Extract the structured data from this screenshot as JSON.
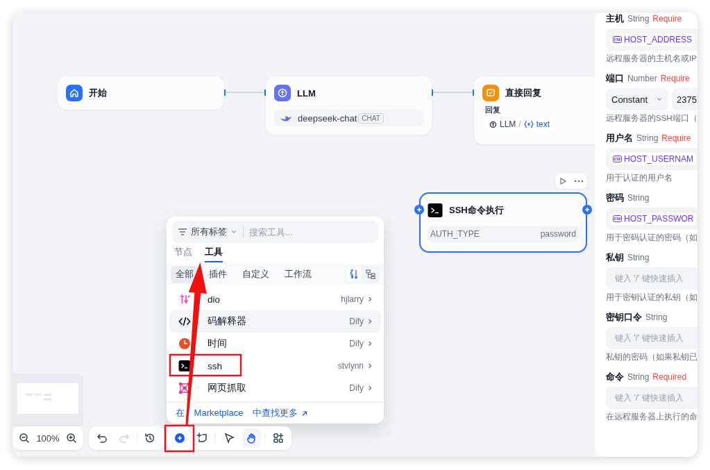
{
  "canvas": {
    "nodes": [
      {
        "kind": "start",
        "title": "开始",
        "selected": false
      },
      {
        "kind": "llm",
        "title": "LLM",
        "model": "deepseek-chat",
        "mode": "CHAT",
        "selected": false
      },
      {
        "kind": "answer",
        "title": "直接回复",
        "output_label": "回复",
        "reference": {
          "node": "LLM",
          "separator": "/",
          "variable": "text"
        },
        "selected": false
      },
      {
        "kind": "tool",
        "title": "SSH命令执行",
        "param_name": "AUTH_TYPE",
        "param_value": "password",
        "selected": true
      }
    ]
  },
  "tool_picker": {
    "tag_filter": "所有标签",
    "search": {
      "placeholder": "搜索工具..."
    },
    "tabs": [
      {
        "label": "节点",
        "selected": false
      },
      {
        "label": "工具",
        "selected": true
      }
    ],
    "categories": [
      {
        "label": "全部",
        "selected": true
      },
      {
        "label": "插件",
        "selected": false
      },
      {
        "label": "自定义",
        "selected": false
      },
      {
        "label": "工作流",
        "selected": false
      }
    ],
    "view_buttons": [
      {
        "kind": "sort",
        "selected": true
      },
      {
        "kind": "tree",
        "selected": false
      }
    ],
    "tools": [
      {
        "kind": "audio",
        "name": "dio",
        "provider": "hjlarry",
        "hovered": false
      },
      {
        "kind": "code",
        "name": "码解释器",
        "provider": "Dify",
        "hovered": true
      },
      {
        "kind": "clock",
        "name": "时间",
        "provider": "Dify",
        "hovered": false
      },
      {
        "kind": "terminal",
        "name": "ssh",
        "provider": "stvlynn",
        "hovered": false
      },
      {
        "kind": "web",
        "name": "网页抓取",
        "provider": "Dify",
        "hovered": false
      }
    ],
    "marketplace_link": "在 Marketplace 中查找更多"
  },
  "toolbar": {
    "zoom": "100%",
    "history": [
      {
        "kind": "undo",
        "disabled": false
      },
      {
        "kind": "redo",
        "disabled": true
      }
    ],
    "modes": [
      {
        "kind": "pointer",
        "selected": false
      },
      {
        "kind": "hand",
        "selected": true
      }
    ]
  },
  "settings_panel": {
    "params": [
      {
        "label": "主机",
        "type": "String",
        "badge": "Require",
        "input": {
          "kind": "env",
          "value": "HOST_ADDRESS"
        },
        "description": "远程服务器的主机名或IP"
      },
      {
        "label": "端口",
        "type": "Number",
        "badge": "Require",
        "input": {
          "kind": "constant",
          "mode": "Constant",
          "value": "2375"
        },
        "description": "远程服务器的SSH端口（"
      },
      {
        "label": "用户名",
        "type": "String",
        "badge": "Require",
        "input": {
          "kind": "env",
          "value": "HOST_USERNAM"
        },
        "description": "用于认证的用户名"
      },
      {
        "label": "密码",
        "type": "String",
        "input": {
          "kind": "env",
          "value": "HOST_PASSWOR"
        },
        "description": "用于密码认证的密码（如"
      },
      {
        "label": "私钥",
        "type": "String",
        "input": {
          "kind": "text",
          "placeholder": "键入 '/' 键快速插入"
        },
        "description": "用于密钥认证的私钥（如"
      },
      {
        "label": "密钥口令",
        "type": "String",
        "input": {
          "kind": "text",
          "placeholder": "键入 '/' 键快速插入"
        },
        "description": "私钥的密码（如果私钥已"
      },
      {
        "label": "命令",
        "type": "String",
        "badge": "Required",
        "input": {
          "kind": "text",
          "placeholder": "键入 '/' 键快速插入"
        },
        "description": "在远程服务器上执行的命"
      }
    ]
  }
}
